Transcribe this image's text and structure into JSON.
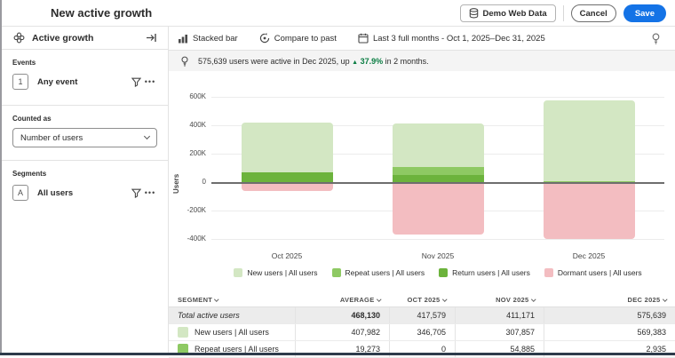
{
  "header": {
    "title": "New active growth",
    "dataset_button": "Demo Web Data",
    "cancel_label": "Cancel",
    "save_label": "Save"
  },
  "sidebar": {
    "title": "Active growth",
    "events_label": "Events",
    "event": {
      "index": "1",
      "name": "Any event"
    },
    "counted_as_label": "Counted as",
    "counted_as_value": "Number of users",
    "segments_label": "Segments",
    "segment": {
      "index": "A",
      "name": "All users"
    }
  },
  "toolbar": {
    "chart_type": "Stacked bar",
    "compare_label": "Compare to past",
    "date_range": "Last 3 full months - Oct 1, 2025–Dec 31, 2025"
  },
  "insight": {
    "prefix": "575,639 users were active in Dec 2025, up",
    "arrow": "▲",
    "delta": "37.9%",
    "suffix": "in 2 months."
  },
  "chart_data": {
    "type": "bar",
    "stacked": true,
    "ylabel": "Users",
    "categories": [
      "Oct 2025",
      "Nov 2025",
      "Dec 2025"
    ],
    "series": [
      {
        "name": "New users | All users",
        "color": "#d3e7c3",
        "values": [
          346705,
          307857,
          569383
        ]
      },
      {
        "name": "Repeat users | All users",
        "color": "#8ec963",
        "values": [
          0,
          54885,
          2935
        ]
      },
      {
        "name": "Return users | All users",
        "color": "#6cb33c",
        "values": [
          70874,
          48429,
          3321
        ]
      },
      {
        "name": "Dormant users | All users",
        "color": "#f3bdc1",
        "values": [
          -65000,
          -370000,
          -400000
        ]
      }
    ],
    "yticks": [
      "600K",
      "400K",
      "200K",
      "0",
      "-200K",
      "-400K"
    ],
    "ylim": [
      -400000,
      600000
    ],
    "grid": true,
    "legend_position": "bottom"
  },
  "table": {
    "columns": [
      "SEGMENT",
      "AVERAGE",
      "OCT 2025",
      "NOV 2025",
      "DEC 2025"
    ],
    "rows": [
      {
        "label": "Total active users",
        "values": [
          "468,130",
          "417,579",
          "411,171",
          "575,639"
        ]
      },
      {
        "label": "New users | All users",
        "swatch": "#d3e7c3",
        "values": [
          "407,982",
          "346,705",
          "307,857",
          "569,383"
        ]
      },
      {
        "label": "Repeat users | All users",
        "swatch": "#8ec963",
        "values": [
          "19,273",
          "0",
          "54,885",
          "2,935"
        ]
      }
    ]
  },
  "colors": {
    "accent": "#1473e6",
    "positive_green": "#0b7d43"
  }
}
